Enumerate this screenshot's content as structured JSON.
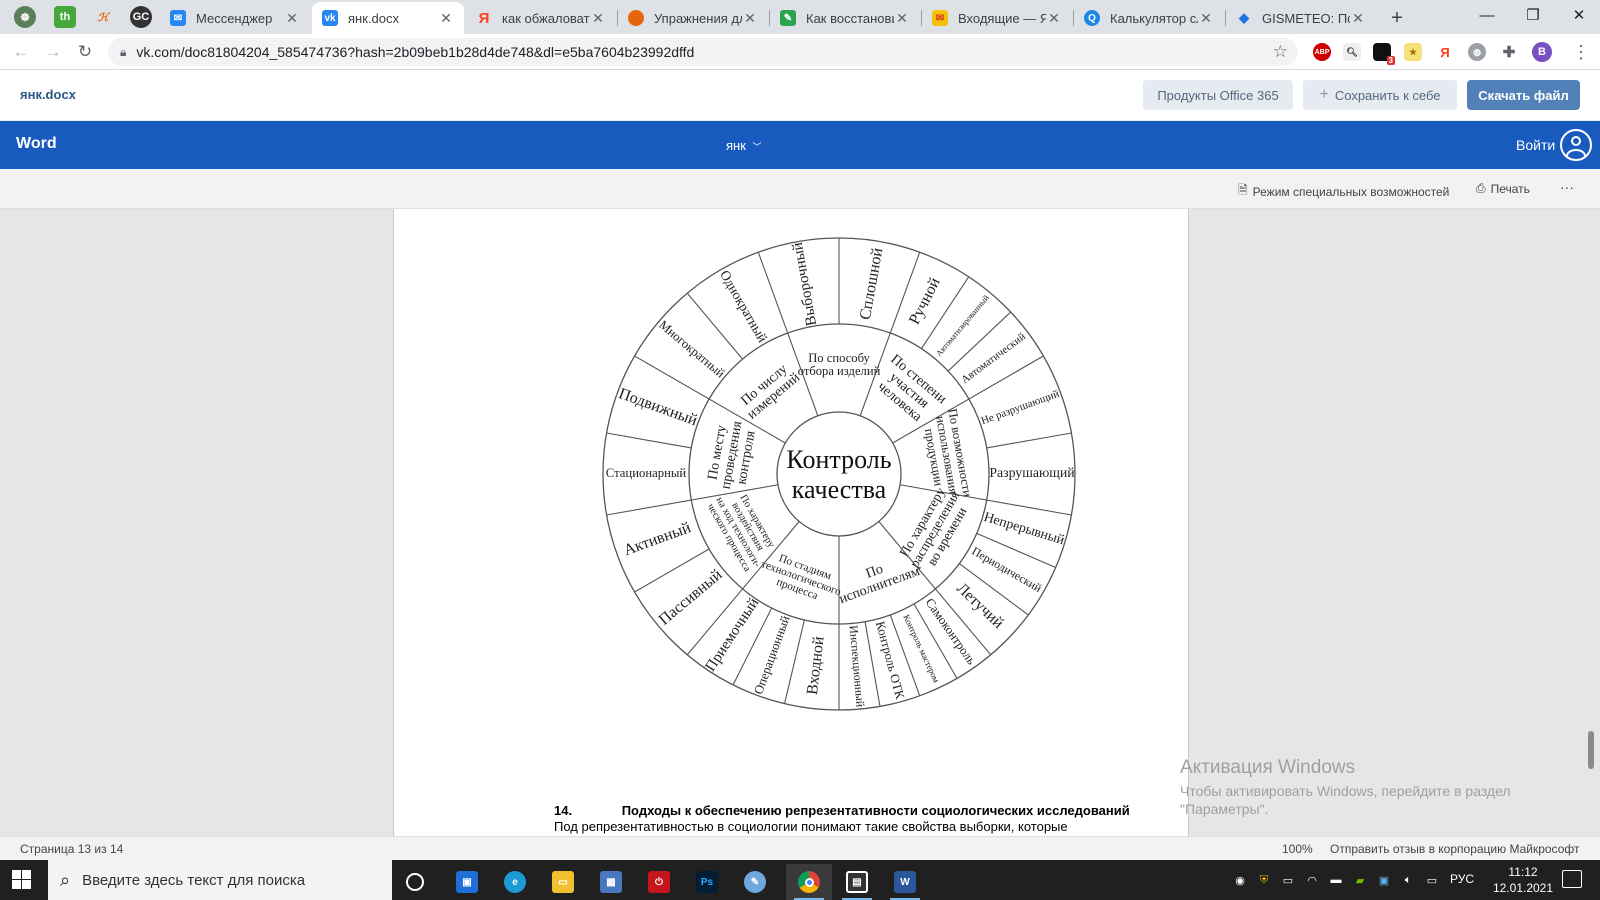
{
  "browser": {
    "tabs": [
      {
        "label": "Мессенджер",
        "icon": "vk-messenger-icon",
        "color": "#2787f5"
      },
      {
        "label": "янк.docx",
        "icon": "vk-icon",
        "color": "#2787f5",
        "active": true
      },
      {
        "label": "как обжаловать",
        "icon": "yandex-icon",
        "color": "#fc3f1d"
      },
      {
        "label": "Упражнения дл",
        "icon": "site-icon",
        "color": "#e8640c"
      },
      {
        "label": "Как восстанови",
        "icon": "site-icon",
        "color": "#2aa44f"
      },
      {
        "label": "Входящие — Ян",
        "icon": "yandex-mail-icon",
        "color": "#f4c20d"
      },
      {
        "label": "Калькулятор сл",
        "icon": "calculator-site-icon",
        "color": "#1e88e5"
      },
      {
        "label": "GISMETEO: Пого",
        "icon": "gismeteo-icon",
        "color": "#1a73e8"
      }
    ],
    "url": "vk.com/doc81804204_585474736?hash=2b09beb1b28d4de748&dl=e5ba7604b23992dffd",
    "abp_badge": "ABP",
    "ext_badge": "3",
    "profile_initial": "В"
  },
  "vk": {
    "file_name": "янк.docx",
    "office_button": "Продукты Office 365",
    "save_button": "Сохранить к себе",
    "download_button": "Скачать файл"
  },
  "word": {
    "app_name": "Word",
    "doc_title": "янк",
    "sign_in": "Войти",
    "accessibility": "Режим специальных возможностей",
    "print": "Печать",
    "more": "···"
  },
  "diagram": {
    "center": [
      "Контроль",
      "качества"
    ],
    "sectors": [
      {
        "label": [
          "По способу",
          "отбора изделий"
        ],
        "items": [
          "Выборочный",
          "Сплошной"
        ]
      },
      {
        "label": [
          "По степени",
          "участия",
          "человека"
        ],
        "items": [
          "Ручной",
          "Автоматизированный",
          "Автоматический"
        ]
      },
      {
        "label": [
          "По возможности",
          "использования",
          "продукции"
        ],
        "items": [
          "Не разрушающий",
          "Разрушающий"
        ]
      },
      {
        "label": [
          "По характеру",
          "распределения",
          "во времени"
        ],
        "items": [
          "Непрерывный",
          "Периодический",
          "Летучий"
        ]
      },
      {
        "label": [
          "По",
          "исполнителям"
        ],
        "items": [
          "Самоконтроль",
          "Контроль мастером",
          "Контроль ОТК",
          "Инспекционный"
        ]
      },
      {
        "label": [
          "По стадиям",
          "технологического",
          "процесса"
        ],
        "items": [
          "Входной",
          "Операционный",
          "Приемочный"
        ]
      },
      {
        "label": [
          "По характеру",
          "воздействия",
          "на ход технологи-",
          "ческого процесса"
        ],
        "items": [
          "Пассивный",
          "Активный"
        ]
      },
      {
        "label": [
          "По месту",
          "проведения",
          "контроля"
        ],
        "items": [
          "Стационарный",
          "Подвижный"
        ]
      },
      {
        "label": [
          "По числу",
          "измерений"
        ],
        "items": [
          "Многократный",
          "Однократный"
        ]
      }
    ]
  },
  "document": {
    "heading_number": "14.",
    "heading_text": "Подходы к обеспечению репрезентативности социологических исследований",
    "body_line": "Под репрезентативностью в социологии понимают такие свойства выборки, которые"
  },
  "watermark": {
    "title": "Активация Windows",
    "line1": "Чтобы активировать Windows, перейдите в раздел",
    "line2": "\"Параметры\"."
  },
  "status": {
    "page": "Страница 13 из 14",
    "zoom": "100%",
    "feedback": "Отправить отзыв в корпорацию Майкрософт"
  },
  "taskbar": {
    "search_placeholder": "Введите здесь текст для поиска",
    "lang": "РУС",
    "time": "11:12",
    "date": "12.01.2021"
  },
  "colors": {
    "vk_accent": "#5181b8",
    "word_blue": "#185abd"
  }
}
